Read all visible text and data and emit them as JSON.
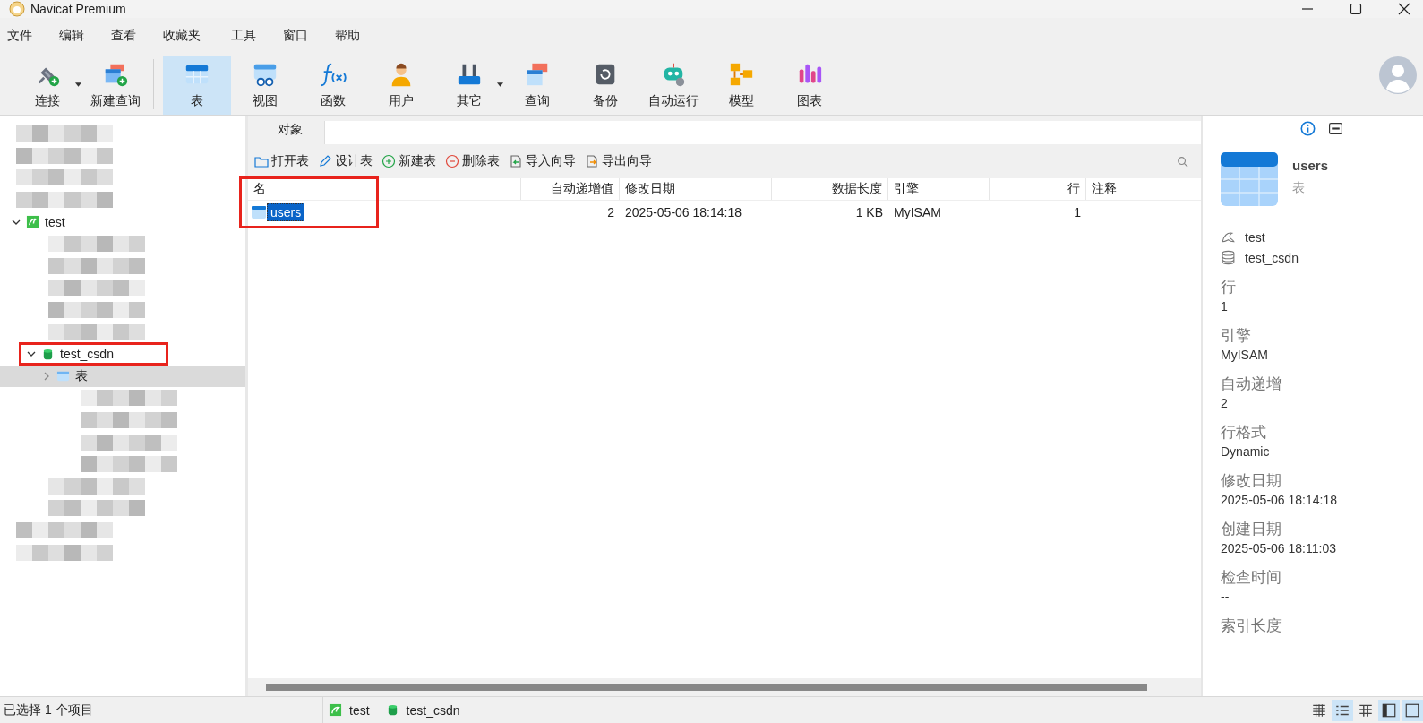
{
  "window": {
    "title": "Navicat Premium"
  },
  "menu": [
    "文件",
    "编辑",
    "查看",
    "收藏夹",
    "工具",
    "窗口",
    "帮助"
  ],
  "toolbar": [
    {
      "label": "连接",
      "kind": "plug",
      "dropdown": true,
      "selected": false
    },
    {
      "label": "新建查询",
      "kind": "newquery",
      "dropdown": false,
      "selected": false
    },
    {
      "label": "表",
      "kind": "table",
      "dropdown": false,
      "selected": true
    },
    {
      "label": "视图",
      "kind": "view",
      "dropdown": false,
      "selected": false
    },
    {
      "label": "函数",
      "kind": "function",
      "dropdown": false,
      "selected": false
    },
    {
      "label": "用户",
      "kind": "user",
      "dropdown": false,
      "selected": false
    },
    {
      "label": "其它",
      "kind": "tools",
      "dropdown": true,
      "selected": false
    },
    {
      "label": "查询",
      "kind": "query",
      "dropdown": false,
      "selected": false
    },
    {
      "label": "备份",
      "kind": "backup",
      "dropdown": false,
      "selected": false
    },
    {
      "label": "自动运行",
      "kind": "robot",
      "dropdown": false,
      "selected": false
    },
    {
      "label": "模型",
      "kind": "model",
      "dropdown": false,
      "selected": false
    },
    {
      "label": "图表",
      "kind": "chart",
      "dropdown": false,
      "selected": false
    }
  ],
  "tree": [
    {
      "kind": "redacted"
    },
    {
      "kind": "redacted"
    },
    {
      "kind": "redacted"
    },
    {
      "kind": "redacted"
    },
    {
      "kind": "connection",
      "label": "test",
      "expanded": true,
      "highlighted": false,
      "selected": false,
      "children": [
        {
          "kind": "redacted"
        },
        {
          "kind": "redacted"
        },
        {
          "kind": "redacted"
        },
        {
          "kind": "redacted"
        },
        {
          "kind": "redacted"
        },
        {
          "kind": "database",
          "label": "test_csdn",
          "expanded": true,
          "highlighted": true,
          "selected": false,
          "children": [
            {
              "kind": "tables",
              "label": "表",
              "expanded": false,
              "highlighted": false,
              "selected": true
            },
            {
              "kind": "redacted"
            },
            {
              "kind": "redacted"
            },
            {
              "kind": "redacted"
            },
            {
              "kind": "redacted"
            }
          ]
        },
        {
          "kind": "redacted"
        },
        {
          "kind": "redacted"
        }
      ]
    },
    {
      "kind": "redacted"
    },
    {
      "kind": "redacted"
    }
  ],
  "object_tab": {
    "label": "对象",
    "selected": true
  },
  "actions": [
    {
      "label": "打开表",
      "kind": "folder"
    },
    {
      "label": "设计表",
      "kind": "pencil"
    },
    {
      "label": "新建表",
      "kind": "plus"
    },
    {
      "label": "删除表",
      "kind": "minus"
    },
    {
      "label": "导入向导",
      "kind": "import"
    },
    {
      "label": "导出向导",
      "kind": "export"
    }
  ],
  "table": {
    "columns": [
      {
        "label": "名",
        "kind": "text",
        "highlighted": true
      },
      {
        "label": "自动递增值",
        "kind": "number",
        "highlighted": false
      },
      {
        "label": "修改日期",
        "kind": "text",
        "highlighted": false
      },
      {
        "label": "数据长度",
        "kind": "number",
        "highlighted": false
      },
      {
        "label": "引擎",
        "kind": "text",
        "highlighted": false
      },
      {
        "label": "行",
        "kind": "number",
        "highlighted": false
      },
      {
        "label": "注释",
        "kind": "text",
        "highlighted": false
      }
    ],
    "rows": [
      {
        "selected": true,
        "cells": [
          "users",
          "2",
          "2025-05-06 18:14:18",
          "1 KB",
          "MyISAM",
          "1",
          ""
        ]
      }
    ]
  },
  "info_panel": {
    "name": "users",
    "type": "表",
    "connection": "test",
    "database": "test_csdn",
    "properties": [
      {
        "label": "行",
        "value": "1"
      },
      {
        "label": "引擎",
        "value": "MyISAM"
      },
      {
        "label": "自动递增",
        "value": "2"
      },
      {
        "label": "行格式",
        "value": "Dynamic"
      },
      {
        "label": "修改日期",
        "value": "2025-05-06 18:14:18"
      },
      {
        "label": "创建日期",
        "value": "2025-05-06 18:11:03"
      },
      {
        "label": "检查时间",
        "value": "--"
      },
      {
        "label": "索引长度"
      }
    ]
  },
  "status_bar": {
    "text": "已选择 1 个项目",
    "connection": "test",
    "database": "test_csdn"
  }
}
